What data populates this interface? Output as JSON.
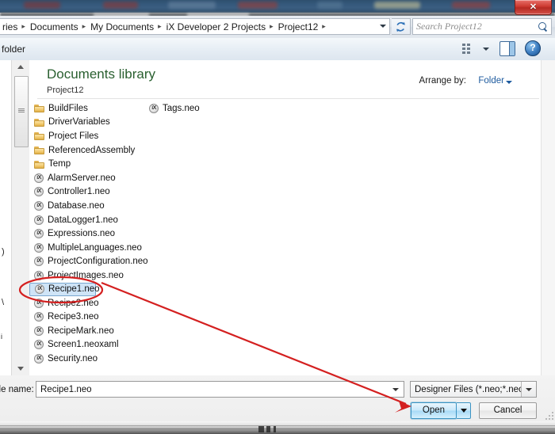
{
  "window": {
    "close_label": "✕"
  },
  "address_bar": {
    "breadcrumbs": [
      {
        "label": "ries",
        "sep": "▸"
      },
      {
        "label": "Documents",
        "sep": "▸"
      },
      {
        "label": "My Documents",
        "sep": "▸"
      },
      {
        "label": "iX Developer 2 Projects",
        "sep": "▸"
      },
      {
        "label": "Project12",
        "sep": "▸"
      }
    ],
    "refresh_icon": "refresh-icon",
    "dropdown_icon": "chevron-down-icon"
  },
  "search": {
    "placeholder": "Search Project12",
    "icon": "search-icon"
  },
  "command_bar": {
    "organize_label": "folder",
    "view_icon": "view-list-icon",
    "view_caret_icon": "chevron-down-icon",
    "preview_pane_icon": "preview-pane-icon",
    "help_label": "?",
    "help_icon": "help-icon"
  },
  "header": {
    "library_title": "Documents library",
    "library_subtitle": "Project12",
    "arrange_label": "Arrange by:",
    "arrange_value": "Folder",
    "arrange_caret_icon": "chevron-down-icon"
  },
  "file_list": {
    "column_1": [
      {
        "name": "BuildFiles",
        "icon": "folder-icon",
        "type": "folder",
        "selected": false
      },
      {
        "name": "DriverVariables",
        "icon": "folder-icon",
        "type": "folder",
        "selected": false
      },
      {
        "name": "Project Files",
        "icon": "folder-icon",
        "type": "folder",
        "selected": false
      },
      {
        "name": "ReferencedAssembly",
        "icon": "folder-icon",
        "type": "folder",
        "selected": false
      },
      {
        "name": "Temp",
        "icon": "folder-icon",
        "type": "folder",
        "selected": false
      },
      {
        "name": "AlarmServer.neo",
        "icon": "ix-file-icon",
        "type": "file",
        "selected": false
      },
      {
        "name": "Controller1.neo",
        "icon": "ix-file-icon",
        "type": "file",
        "selected": false
      },
      {
        "name": "Database.neo",
        "icon": "ix-file-icon",
        "type": "file",
        "selected": false
      },
      {
        "name": "DataLogger1.neo",
        "icon": "ix-file-icon",
        "type": "file",
        "selected": false
      },
      {
        "name": "Expressions.neo",
        "icon": "ix-file-icon",
        "type": "file",
        "selected": false
      },
      {
        "name": "MultipleLanguages.neo",
        "icon": "ix-file-icon",
        "type": "file",
        "selected": false
      },
      {
        "name": "ProjectConfiguration.neo",
        "icon": "ix-file-icon",
        "type": "file",
        "selected": false
      },
      {
        "name": "ProjectImages.neo",
        "icon": "ix-file-icon",
        "type": "file",
        "selected": false
      },
      {
        "name": "Recipe1.neo",
        "icon": "ix-file-icon",
        "type": "file",
        "selected": true
      },
      {
        "name": "Recipe2.neo",
        "icon": "ix-file-icon",
        "type": "file",
        "selected": false
      },
      {
        "name": "Recipe3.neo",
        "icon": "ix-file-icon",
        "type": "file",
        "selected": false
      },
      {
        "name": "RecipeMark.neo",
        "icon": "ix-file-icon",
        "type": "file",
        "selected": false
      },
      {
        "name": "Screen1.neoxaml",
        "icon": "ix-file-icon",
        "type": "file",
        "selected": false
      },
      {
        "name": "Security.neo",
        "icon": "ix-file-icon",
        "type": "file",
        "selected": false
      }
    ],
    "column_2": [
      {
        "name": "Tags.neo",
        "icon": "ix-file-icon",
        "type": "file",
        "selected": false
      }
    ],
    "ix_icon_text": "iX"
  },
  "form": {
    "file_name_label": "ile name:",
    "file_name_value": "Recipe1.neo",
    "file_name_caret_icon": "chevron-down-icon",
    "filter_value": "Designer Files (*.neo;*.neoxaml",
    "filter_caret_icon": "chevron-down-icon",
    "open_label": "Open",
    "open_split_icon": "chevron-down-icon",
    "cancel_label": "Cancel"
  },
  "annotation": {
    "ellipse_color": "#d42020",
    "arrow_color": "#d42020",
    "target": "Recipe1.neo",
    "points_to": "Open"
  },
  "colors": {
    "accent_blue": "#1d5a9e",
    "library_green": "#2a6030",
    "selection_fill": "#cfe4f7",
    "selection_border": "#7aa7cf",
    "open_button_border": "#3c93c2"
  }
}
